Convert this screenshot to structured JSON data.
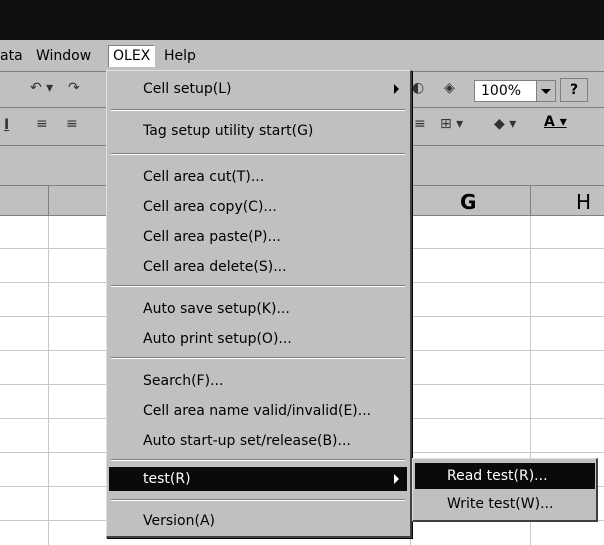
{
  "menubar": {
    "items": [
      {
        "label": "ata"
      },
      {
        "label": "Window"
      },
      {
        "label": "OLEX"
      },
      {
        "label": "Help"
      }
    ]
  },
  "toolbar": {
    "zoom": "100%",
    "help": "?"
  },
  "columns": [
    "G",
    "H"
  ],
  "partial_col": "[",
  "olex_menu": {
    "items": [
      {
        "label": "Cell setup(L)",
        "submenu": true
      },
      {
        "label": "Tag setup utility start(G)"
      },
      {
        "label": "Cell area cut(T)..."
      },
      {
        "label": "Cell area copy(C)..."
      },
      {
        "label": "Cell area paste(P)..."
      },
      {
        "label": "Cell area delete(S)..."
      },
      {
        "label": "Auto save setup(K)..."
      },
      {
        "label": "Auto print setup(O)..."
      },
      {
        "label": "Search(F)..."
      },
      {
        "label": "Cell area name valid/invalid(E)..."
      },
      {
        "label": "Auto start-up set/release(B)..."
      },
      {
        "label": "test(R)",
        "submenu": true
      },
      {
        "label": "Version(A)"
      }
    ]
  },
  "test_submenu": {
    "items": [
      {
        "label": "Read test(R)..."
      },
      {
        "label": "Write test(W)..."
      }
    ]
  }
}
